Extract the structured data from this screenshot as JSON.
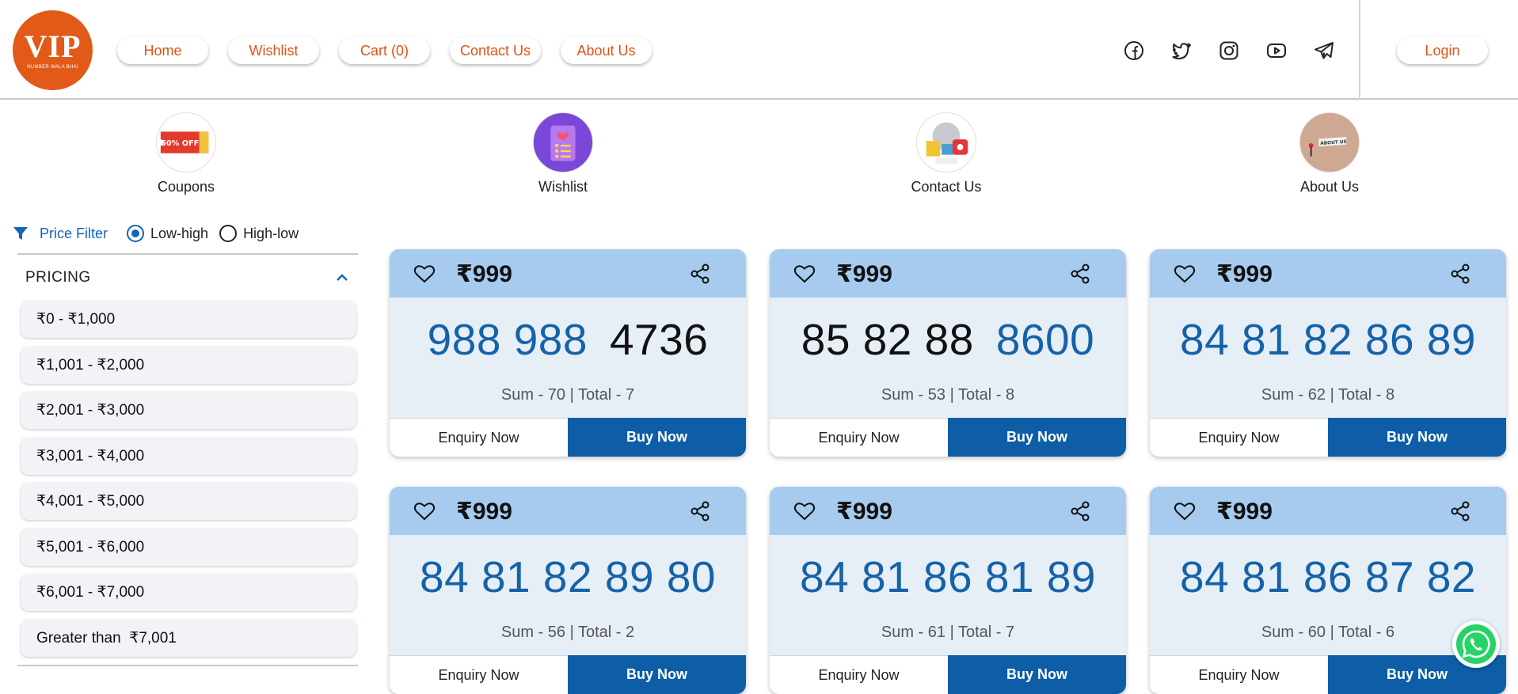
{
  "brand": {
    "logo_main": "VIP",
    "logo_sub": "NUMBER WALA BHAI",
    "color": "#e25a17"
  },
  "nav": {
    "home": "Home",
    "wishlist": "Wishlist",
    "cart": "Cart (0)",
    "contact": "Contact Us",
    "about": "About Us",
    "login": "Login"
  },
  "social_icons": [
    "facebook-icon",
    "twitter-icon",
    "instagram-icon",
    "youtube-icon",
    "telegram-icon"
  ],
  "categories": [
    {
      "label": "Coupons",
      "icon": "coupon-icon",
      "badge_text": "50% OFF"
    },
    {
      "label": "Wishlist",
      "icon": "wishlist-icon"
    },
    {
      "label": "Contact Us",
      "icon": "contact-icon"
    },
    {
      "label": "About Us",
      "icon": "about-icon",
      "badge_text": "ABOUT US"
    }
  ],
  "filter": {
    "label": "Price Filter",
    "option_low_high": "Low-high",
    "option_high_low": "High-low",
    "selected": "Low-high"
  },
  "sidebar": {
    "heading": "PRICING",
    "options": [
      "₹0 - ₹1,000",
      "₹1,001 - ₹2,000",
      "₹2,001 - ₹3,000",
      "₹3,001 - ₹4,000",
      "₹4,001 - ₹5,000",
      "₹5,001 - ₹6,000",
      "₹6,001 - ₹7,000",
      "Greater than  ₹7,001"
    ]
  },
  "cards": [
    {
      "price": "₹999",
      "number_blue": "988 988",
      "number_black": "4736",
      "sum_total": "Sum - 70 | Total - 7",
      "enquiry": "Enquiry Now",
      "buy": "Buy Now"
    },
    {
      "price": "₹999",
      "number_black": "85 82 88",
      "number_blue": "8600",
      "sum_total": "Sum - 53 | Total - 8",
      "enquiry": "Enquiry Now",
      "buy": "Buy Now"
    },
    {
      "price": "₹999",
      "number": "84 81 82 86 89",
      "sum_total": "Sum - 62 | Total - 8",
      "enquiry": "Enquiry Now",
      "buy": "Buy Now"
    },
    {
      "price": "₹999",
      "number": "84 81 82 89 80",
      "sum_total": "Sum - 56 | Total - 2",
      "enquiry": "Enquiry Now",
      "buy": "Buy Now"
    },
    {
      "price": "₹999",
      "number": "84 81 86 81 89",
      "sum_total": "Sum - 61 | Total - 7",
      "enquiry": "Enquiry Now",
      "buy": "Buy Now"
    },
    {
      "price": "₹999",
      "number": "84 81 86 87 82",
      "sum_total": "Sum - 60 | Total - 6",
      "enquiry": "Enquiry Now",
      "buy": "Buy Now"
    }
  ],
  "colors": {
    "accent": "#e05316",
    "primary_blue": "#0d5ea6",
    "card_header": "#a6cbee",
    "card_body": "#e6eef6",
    "whatsapp": "#25d366"
  }
}
